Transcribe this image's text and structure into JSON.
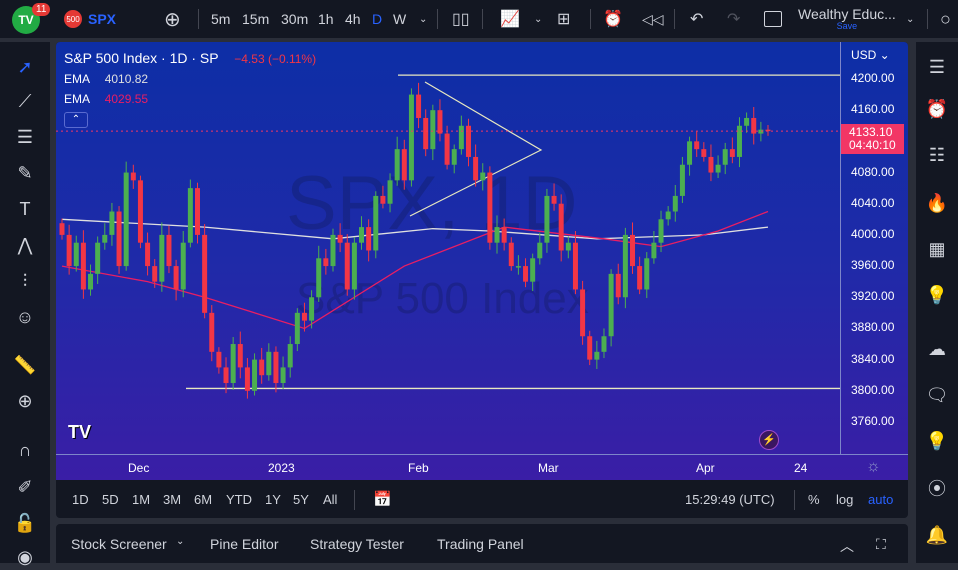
{
  "header": {
    "notifications": "11",
    "logo_text": "TV",
    "symbol_badge": "500",
    "symbol": "SPX",
    "intervals": [
      "5m",
      "15m",
      "30m",
      "1h",
      "4h",
      "D",
      "W"
    ],
    "active_interval": "D",
    "layout_name": "Wealthy Educ...",
    "save_label": "Save"
  },
  "legend": {
    "title": "S&P 500 Index · 1D · SP",
    "change": "−4.53 (−0.11%)",
    "ema1_label": "EMA",
    "ema1_value": "4010.82",
    "ema2_label": "EMA",
    "ema2_value": "4029.55"
  },
  "watermark": {
    "line1": "SPX, 1D",
    "line2": "S&P 500 Index"
  },
  "price_axis": {
    "currency": "USD",
    "labels": [
      "4200.00",
      "4160.00",
      "4120.00",
      "4080.00",
      "4040.00",
      "4000.00",
      "3960.00",
      "3920.00",
      "3880.00",
      "3840.00",
      "3800.00",
      "3760.00"
    ],
    "last_price": "4133.10",
    "countdown": "04:40:10"
  },
  "time_axis": {
    "labels": [
      "Dec",
      "2023",
      "Feb",
      "Mar",
      "Apr",
      "24"
    ]
  },
  "range_bar": {
    "ranges": [
      "1D",
      "5D",
      "1M",
      "3M",
      "6M",
      "YTD",
      "1Y",
      "5Y",
      "All"
    ],
    "clock": "15:29:49 (UTC)",
    "percent": "%",
    "log": "log",
    "auto": "auto"
  },
  "bottom_panel": {
    "tabs": [
      "Stock Screener",
      "Pine Editor",
      "Strategy Tester",
      "Trading Panel"
    ]
  },
  "colors": {
    "up": "#4caf50",
    "down": "#f23645",
    "ema_fast": "#e91e63",
    "ema_slow": "#e0e0e0",
    "accent": "#2962ff"
  },
  "chart_data": {
    "type": "candlestick",
    "ylim": [
      3740,
      4230
    ],
    "closes": [
      4000,
      3960,
      3990,
      3930,
      3950,
      3990,
      4000,
      4030,
      3960,
      4080,
      4070,
      3990,
      3960,
      3940,
      4000,
      3960,
      3930,
      3990,
      4060,
      4000,
      3900,
      3850,
      3830,
      3810,
      3860,
      3830,
      3800,
      3840,
      3820,
      3850,
      3810,
      3830,
      3860,
      3900,
      3890,
      3920,
      3970,
      3960,
      4000,
      3990,
      3930,
      3990,
      4010,
      3980,
      4050,
      4040,
      4070,
      4110,
      4070,
      4180,
      4150,
      4110,
      4160,
      4130,
      4090,
      4110,
      4140,
      4100,
      4070,
      4080,
      3990,
      4010,
      3990,
      3960,
      3960,
      3940,
      3970,
      3990,
      4050,
      4040,
      3980,
      3990,
      3930,
      3870,
      3840,
      3850,
      3870,
      3950,
      3920,
      4000,
      3960,
      3930,
      3970,
      3990,
      4020,
      4030,
      4050,
      4090,
      4120,
      4110,
      4100,
      4080,
      4090,
      4110,
      4100,
      4140,
      4150,
      4130,
      4135,
      4133.1
    ],
    "ema_slow": [
      [
        0,
        4020
      ],
      [
        20,
        4010
      ],
      [
        38,
        3995
      ],
      [
        52,
        4008
      ],
      [
        60,
        4005
      ],
      [
        75,
        3995
      ],
      [
        90,
        4000
      ],
      [
        99,
        4010
      ]
    ],
    "ema_fast": [
      [
        0,
        3960
      ],
      [
        12,
        3940
      ],
      [
        20,
        3920
      ],
      [
        34,
        3880
      ],
      [
        48,
        3960
      ],
      [
        62,
        4010
      ],
      [
        76,
        3995
      ],
      [
        84,
        3985
      ],
      [
        92,
        4005
      ],
      [
        99,
        4030
      ]
    ],
    "resistance": 4205,
    "support": 3803
  }
}
